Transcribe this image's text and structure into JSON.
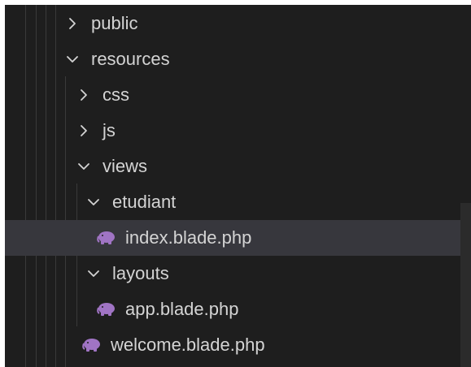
{
  "explorer": {
    "items": [
      {
        "label": "public",
        "kind": "folder",
        "expanded": false,
        "icon": "chevron-right-icon"
      },
      {
        "label": "resources",
        "kind": "folder",
        "expanded": true,
        "icon": "chevron-down-icon"
      },
      {
        "label": "css",
        "kind": "folder",
        "expanded": false,
        "icon": "chevron-right-icon"
      },
      {
        "label": "js",
        "kind": "folder",
        "expanded": false,
        "icon": "chevron-right-icon"
      },
      {
        "label": "views",
        "kind": "folder",
        "expanded": true,
        "icon": "chevron-down-icon"
      },
      {
        "label": "etudiant",
        "kind": "folder",
        "expanded": true,
        "icon": "chevron-down-icon"
      },
      {
        "label": "index.blade.php",
        "kind": "file",
        "selected": true,
        "icon": "php-elephant-icon"
      },
      {
        "label": "layouts",
        "kind": "folder",
        "expanded": true,
        "icon": "chevron-down-icon"
      },
      {
        "label": "app.blade.php",
        "kind": "file",
        "icon": "php-elephant-icon"
      },
      {
        "label": "welcome.blade.php",
        "kind": "file",
        "icon": "php-elephant-icon"
      }
    ]
  },
  "colors": {
    "background": "#1e1e1e",
    "text": "#d4d4d4",
    "selected_row": "#37373d",
    "php_icon": "#a074c4"
  }
}
